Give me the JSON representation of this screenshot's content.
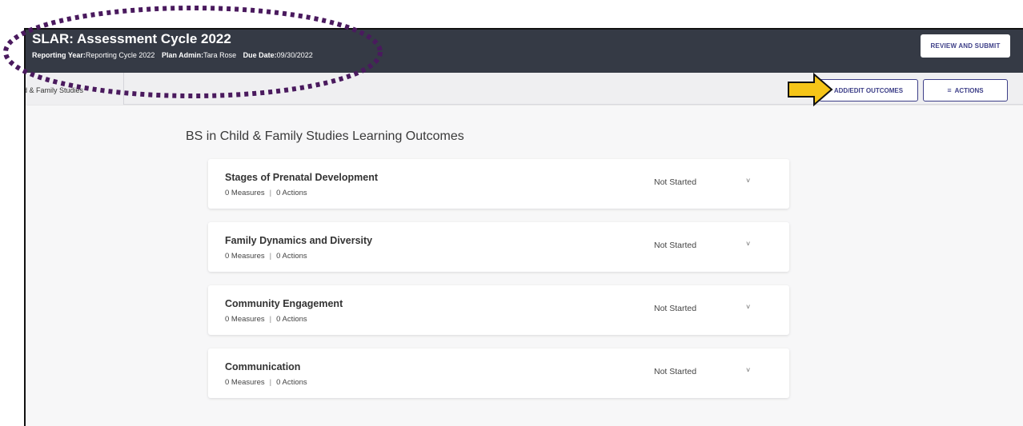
{
  "header": {
    "title": "SLAR: Assessment Cycle 2022",
    "reporting_year_label": "Reporting Year:",
    "reporting_year": "Reporting Cycle 2022",
    "plan_admin_label": "Plan Admin:",
    "plan_admin": "Tara Rose",
    "due_date_label": "Due Date:",
    "due_date": "09/30/2022",
    "review_button": "REVIEW AND SUBMIT"
  },
  "tabbar": {
    "active_tab": "hild & Family Studies",
    "add_edit_button": "ADD/EDIT OUTCOMES",
    "actions_icon": "≡",
    "actions_button": "ACTIONS"
  },
  "main": {
    "section_title": "BS in Child & Family Studies Learning Outcomes",
    "outcomes": [
      {
        "title": "Stages of Prenatal Development",
        "measures": "0 Measures",
        "separator": "|",
        "actions": "0 Actions",
        "status": "Not Started",
        "chevron": "˅"
      },
      {
        "title": "Family Dynamics and Diversity",
        "measures": "0 Measures",
        "separator": "|",
        "actions": "0 Actions",
        "status": "Not Started",
        "chevron": "˅"
      },
      {
        "title": "Community Engagement",
        "measures": "0 Measures",
        "separator": "|",
        "actions": "0 Actions",
        "status": "Not Started",
        "chevron": "˅"
      },
      {
        "title": "Communication",
        "measures": "0 Measures",
        "separator": "|",
        "actions": "0 Actions",
        "status": "Not Started",
        "chevron": "˅"
      }
    ]
  },
  "colors": {
    "header_bg": "#353a45",
    "accent": "#3d3f88",
    "annotation_dots": "#4a1a5e",
    "arrow_fill": "#f5c518"
  },
  "icons": {
    "callout_arrow": "arrow-right-icon",
    "annotation_ellipse": "dotted-ellipse"
  }
}
